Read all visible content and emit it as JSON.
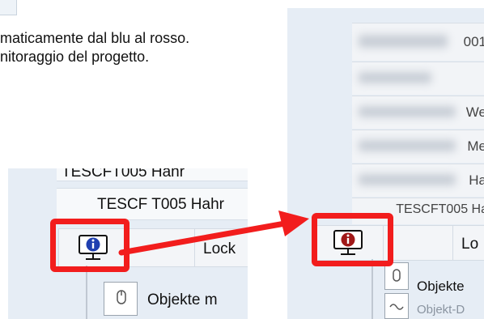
{
  "caption": {
    "line1": "maticamente dal blu al rosso.",
    "line2": "nitoraggio del progetto."
  },
  "left_view": {
    "row_top": "TESCF T005 Hahr",
    "row_top_partial": "TESCFT005 Hahr",
    "lock_label": "Lock",
    "objects_label": "Objekte m",
    "status_icon": "monitor-info-icon",
    "status_color": "#1f3fb0"
  },
  "right_view": {
    "row_partials": [
      "001",
      "We",
      "Me",
      "Ha",
      "TESCFT005 Ha"
    ],
    "lock_label": "Lo",
    "objects_label": "Objekte",
    "objects2_label": "Objekt-D",
    "status_icon": "monitor-info-icon",
    "status_color": "#a01818"
  },
  "colors": {
    "highlight": "#f21d1d",
    "blue": "#1f3fb0",
    "red": "#a01818"
  }
}
